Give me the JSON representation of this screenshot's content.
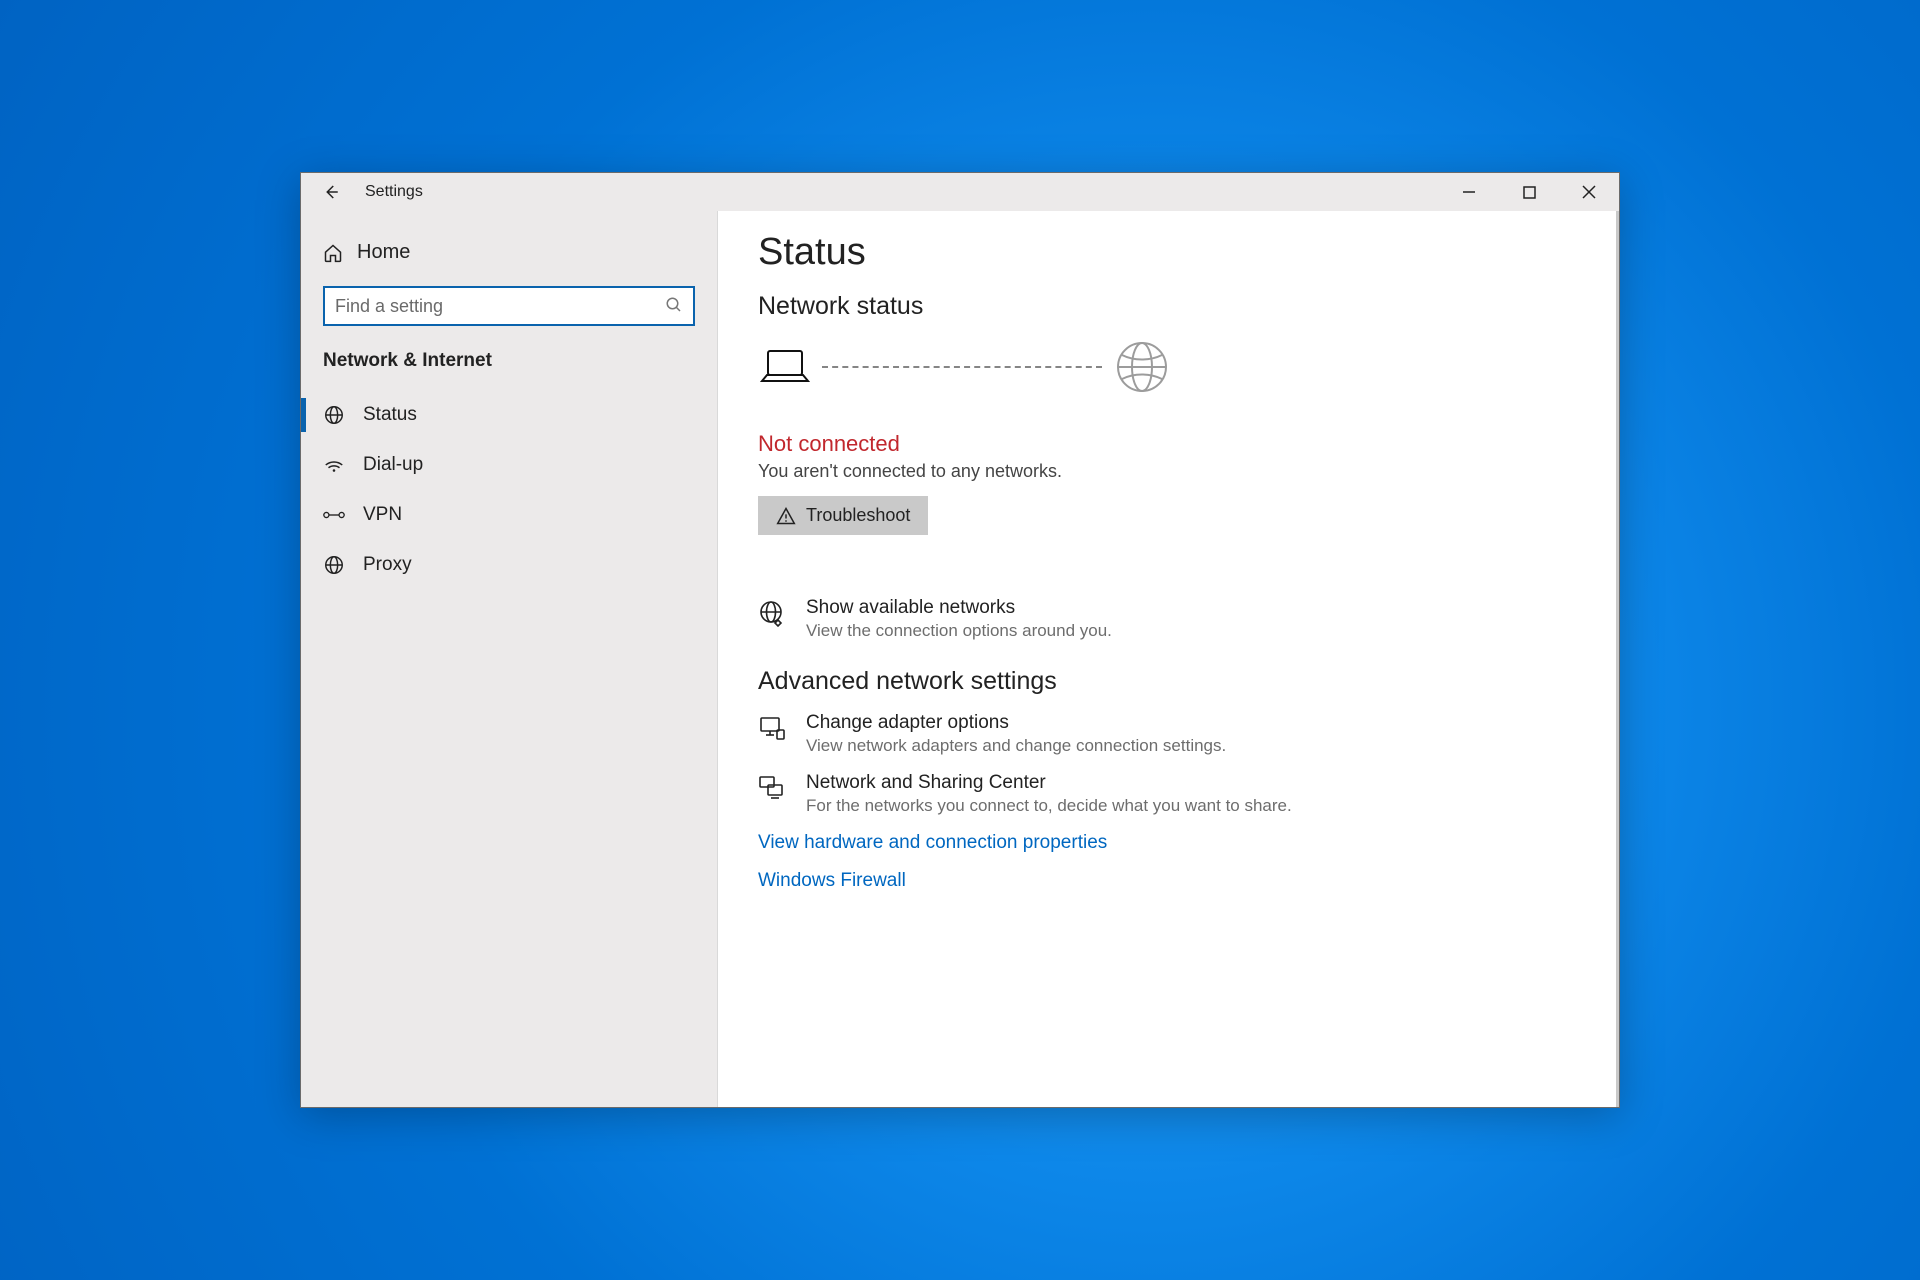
{
  "window": {
    "title": "Settings"
  },
  "sidebar": {
    "home": "Home",
    "search_placeholder": "Find a setting",
    "category": "Network & Internet",
    "items": [
      {
        "label": "Status"
      },
      {
        "label": "Dial-up"
      },
      {
        "label": "VPN"
      },
      {
        "label": "Proxy"
      }
    ]
  },
  "page": {
    "title": "Status",
    "section_network_status": "Network status",
    "not_connected": "Not connected",
    "not_connected_desc": "You aren't connected to any networks.",
    "troubleshoot": "Troubleshoot",
    "show_networks_title": "Show available networks",
    "show_networks_desc": "View the connection options around you.",
    "advanced_heading": "Advanced network settings",
    "adapter_title": "Change adapter options",
    "adapter_desc": "View network adapters and change connection settings.",
    "sharing_title": "Network and Sharing Center",
    "sharing_desc": "For the networks you connect to, decide what you want to share.",
    "link_hardware": "View hardware and connection properties",
    "link_firewall": "Windows Firewall"
  },
  "colors": {
    "accent": "#0a63ad",
    "danger": "#c1272d",
    "link": "#0067c0"
  }
}
